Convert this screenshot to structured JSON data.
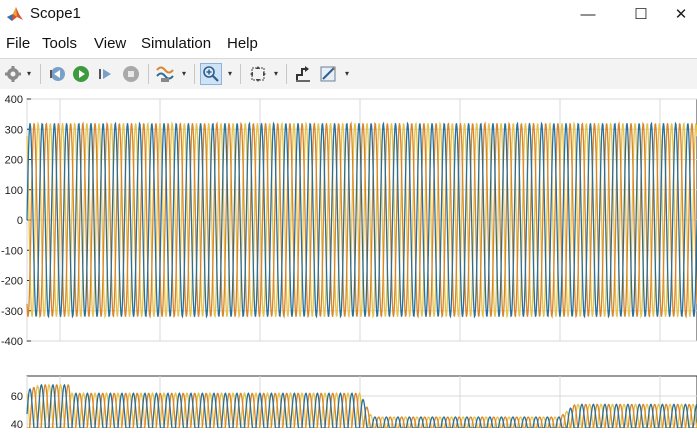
{
  "window": {
    "title": "Scope1",
    "controls": [
      "—",
      "☐",
      "✕"
    ]
  },
  "menu": [
    "File",
    "Tools",
    "View",
    "Simulation",
    "Help"
  ],
  "toolbar": {
    "icons": [
      "gear-icon",
      "step-back-icon",
      "run-icon",
      "step-forward-icon",
      "stop-icon",
      "signal-select-icon",
      "zoom-in-icon",
      "fit-to-view-icon",
      "triggers-icon",
      "cursor-measure-icon"
    ]
  },
  "colors": {
    "series_blue": "#2a6f97",
    "series_orange": "#d9862b",
    "series_yellow": "#e5c34d",
    "grid": "#d8d8d8"
  },
  "chart_data": [
    {
      "type": "line",
      "ylim": [
        -400,
        400
      ],
      "yticks": [
        "400",
        "300",
        "200",
        "100",
        "0",
        "-100",
        "-200",
        "-300",
        "-400"
      ],
      "grid": true,
      "series": [
        {
          "color": "blue",
          "amplitude": 320,
          "phase_deg": 0
        },
        {
          "color": "orange",
          "amplitude": 320,
          "phase_deg": -120
        },
        {
          "color": "yellow",
          "amplitude": 320,
          "phase_deg": 120
        }
      ],
      "cycles_visible": 55
    },
    {
      "type": "line",
      "yticks": [
        "60",
        "40"
      ],
      "grid": true,
      "series": [
        {
          "color": "blue"
        },
        {
          "color": "orange"
        },
        {
          "color": "yellow"
        }
      ],
      "envelope_peaks": [
        68,
        62,
        45,
        54
      ]
    }
  ]
}
